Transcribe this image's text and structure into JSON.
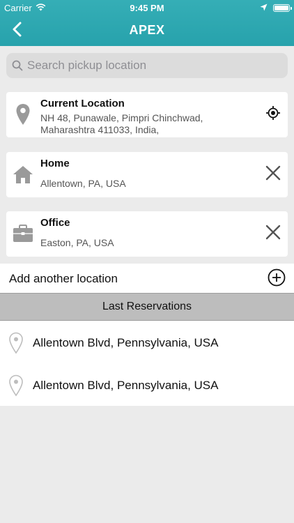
{
  "status_bar": {
    "carrier": "Carrier",
    "time": "9:45 PM",
    "icons": [
      "wifi-icon",
      "location-arrow-icon",
      "battery-icon"
    ]
  },
  "nav": {
    "title": "APEX",
    "back_icon": "chevron-left-icon"
  },
  "search": {
    "placeholder": "Search pickup location",
    "value": "",
    "icon": "search-icon"
  },
  "saved_locations": [
    {
      "title": "Current Location",
      "address": "NH 48, Punawale, Pimpri Chinchwad,\nMaharashtra 411033, India,",
      "icon": "map-pin-icon",
      "action_icon": "crosshair-icon"
    },
    {
      "title": "Home",
      "address": "Allentown, PA, USA",
      "icon": "home-icon",
      "action_icon": "close-icon"
    },
    {
      "title": "Office",
      "address": "Easton, PA, USA",
      "icon": "briefcase-icon",
      "action_icon": "close-icon"
    }
  ],
  "add_location": {
    "label": "Add another location",
    "icon": "plus-circle-icon"
  },
  "last_reservations": {
    "header": "Last Reservations",
    "items": [
      {
        "label": "Allentown Blvd, Pennsylvania, USA",
        "icon": "map-pin-outline-icon"
      },
      {
        "label": "Allentown Blvd, Pennsylvania, USA",
        "icon": "map-pin-outline-icon"
      }
    ]
  },
  "colors": {
    "header": "#2ea8b1",
    "background": "#ebebeb",
    "section_header": "#bdbdbd",
    "icon_gray": "#9a9a9a"
  }
}
